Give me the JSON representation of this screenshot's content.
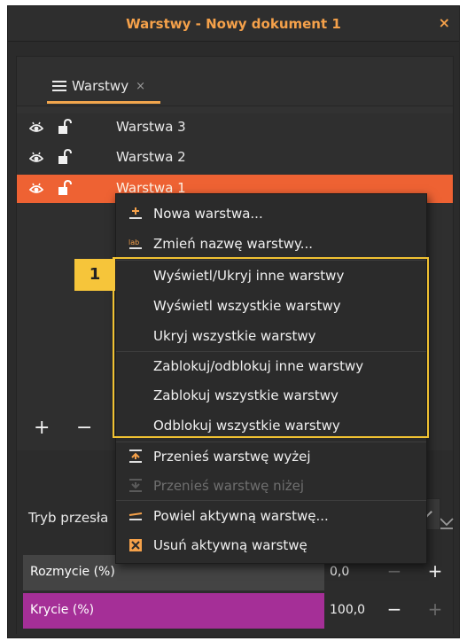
{
  "window": {
    "title": "Warstwy - Nowy dokument 1",
    "close_label": "×"
  },
  "tab": {
    "label": "Warstwy",
    "close": "×"
  },
  "layers": [
    {
      "name": "Warstwa 3",
      "selected": false
    },
    {
      "name": "Warstwa 2",
      "selected": false
    },
    {
      "name": "Warstwa 1",
      "selected": true
    }
  ],
  "toolbar": {
    "add": "+",
    "remove": "−"
  },
  "blend_mode": {
    "label": "Tryb przesła"
  },
  "sliders": {
    "blur": {
      "label": "Rozmycie (%)",
      "value": "0,0",
      "fraction": 0.0,
      "minus": "−",
      "plus": "+"
    },
    "opacity": {
      "label": "Krycie (%)",
      "value": "100,0",
      "fraction": 1.0,
      "minus": "−",
      "plus": "+"
    }
  },
  "context_menu": {
    "items": [
      {
        "label": "Nowa warstwa...",
        "icon": "new-layer-icon",
        "disabled": false
      },
      {
        "label": "Zmień nazwę warstwy...",
        "icon": "rename-icon",
        "disabled": false
      },
      {
        "label": "Wyświetl/Ukryj inne warstwy",
        "icon": "",
        "disabled": false
      },
      {
        "label": "Wyświetl wszystkie warstwy",
        "icon": "",
        "disabled": false
      },
      {
        "label": "Ukryj wszystkie warstwy",
        "icon": "",
        "disabled": false
      },
      {
        "label": "Zablokuj/odblokuj inne warstwy",
        "icon": "",
        "disabled": false
      },
      {
        "label": "Zablokuj wszystkie warstwy",
        "icon": "",
        "disabled": false
      },
      {
        "label": "Odblokuj wszystkie warstwy",
        "icon": "",
        "disabled": false
      },
      {
        "label": "Przenieś warstwę wyżej",
        "icon": "move-up-icon",
        "disabled": false
      },
      {
        "label": "Przenieś warstwę niżej",
        "icon": "move-down-icon",
        "disabled": true
      },
      {
        "label": "Powiel aktywną warstwę...",
        "icon": "duplicate-icon",
        "disabled": false
      },
      {
        "label": "Usuń aktywną warstwę",
        "icon": "delete-icon",
        "disabled": false
      }
    ]
  },
  "callout": {
    "number": "1"
  },
  "colors": {
    "accent": "#f5a14a",
    "selected_row": "#ee6233",
    "highlight": "#f1c232",
    "blur_fill": "#444444",
    "opacity_fill": "#a52f97"
  }
}
